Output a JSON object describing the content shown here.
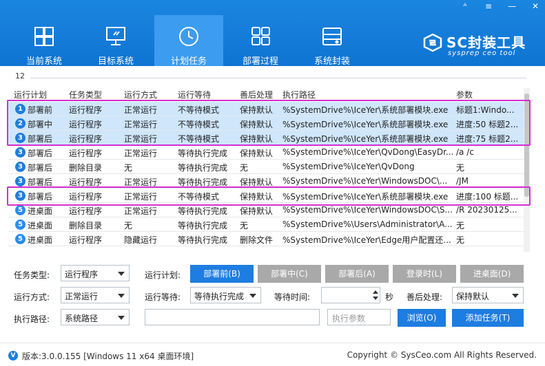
{
  "window_controls": [
    "ᴬ",
    "≡",
    "—",
    "✕"
  ],
  "nav": {
    "tabs": [
      {
        "label": "当前系统",
        "icon": "windows-icon"
      },
      {
        "label": "目标系统",
        "icon": "monitor-icon"
      },
      {
        "label": "计划任务",
        "icon": "clock-icon",
        "active": true
      },
      {
        "label": "部署过程",
        "icon": "grid-icon"
      },
      {
        "label": "系统封装",
        "icon": "drive-icon"
      }
    ]
  },
  "brand": {
    "name": "SC封装工具",
    "subtitle": "sysprep ceo tool"
  },
  "grid": {
    "count": "12",
    "columns": [
      "运行计划",
      "任务类型",
      "运行方式",
      "运行等待",
      "善后处理",
      "执行路径",
      "参数"
    ],
    "rows": [
      {
        "badge": "1",
        "plan": "部署前",
        "type": "运行程序",
        "mode": "正常运行",
        "wait": "不等待模式",
        "after": "保持默认",
        "path": "%SystemDrive%\\IceYer\\系统部署模块.exe",
        "param": "标题1:Windo..."
      },
      {
        "badge": "2",
        "plan": "部署中",
        "type": "运行程序",
        "mode": "正常运行",
        "wait": "不等待模式",
        "after": "保持默认",
        "path": "%SystemDrive%\\IceYer\\系统部署模块.exe",
        "param": "进度:50 标题2..."
      },
      {
        "badge": "3",
        "plan": "部署后",
        "type": "运行程序",
        "mode": "正常运行",
        "wait": "不等待模式",
        "after": "保持默认",
        "path": "%SystemDrive%\\IceYer\\系统部署模块.exe",
        "param": "进度:75 标题2..."
      },
      {
        "badge": "3",
        "plan": "部署后",
        "type": "运行程序",
        "mode": "正常运行",
        "wait": "等待执行完成",
        "after": "保持默认",
        "path": "%SystemDrive%\\IceYer\\QvDong\\EasyDr...",
        "param": "/a /c"
      },
      {
        "badge": "3",
        "plan": "部署后",
        "type": "删除目录",
        "mode": "无",
        "wait": "等待执行完成",
        "after": "无",
        "path": "%SystemDrive%\\IceYer\\QvDong",
        "param": "无"
      },
      {
        "badge": "3",
        "plan": "部署后",
        "type": "运行程序",
        "mode": "正常运行",
        "wait": "等待执行完成",
        "after": "保持默认",
        "path": "%SystemDrive%\\IceYer\\WindowsDOC\\...",
        "param": "/JM"
      },
      {
        "badge": "3",
        "plan": "部署后",
        "type": "运行程序",
        "mode": "正常运行",
        "wait": "不等待模式",
        "after": "保持默认",
        "path": "%SystemDrive%\\IceYer\\系统部署模块.exe",
        "param": "进度:100 标题..."
      },
      {
        "badge": "5",
        "plan": "进桌面",
        "type": "运行程序",
        "mode": "正常运行",
        "wait": "等待执行完成",
        "after": "保持默认",
        "path": "%SystemDrive%\\IceYer\\WindowsDOC\\S...",
        "param": "/R 20230125..."
      },
      {
        "badge": "5",
        "plan": "进桌面",
        "type": "删除目录",
        "mode": "无",
        "wait": "等待执行完成",
        "after": "无",
        "path": "%SystemDrive%\\Users\\Administrator\\A...",
        "param": "无"
      },
      {
        "badge": "5",
        "plan": "进桌面",
        "type": "运行程序",
        "mode": "隐藏运行",
        "wait": "等待执行完成",
        "after": "删除文件",
        "path": "%SystemDrive%\\IceYer\\Edge用户配置还...",
        "param": "无"
      }
    ]
  },
  "form": {
    "task_type_label": "任务类型:",
    "task_type_value": "运行程序",
    "run_plan_label": "运行计划:",
    "plan_buttons": [
      "部署前(B)",
      "部署中(C)",
      "部署后(A)",
      "登录时(L)",
      "进桌面(D)"
    ],
    "run_mode_label": "运行方式:",
    "run_mode_value": "正常运行",
    "run_wait_label": "运行等待:",
    "run_wait_value": "等待执行完成",
    "wait_time_label": "等待时间:",
    "wait_time_unit": "秒",
    "after_label": "善后处理:",
    "after_value": "保持默认",
    "exec_path_label": "执行路径:",
    "exec_path_value": "系统路径",
    "exec_param_placeholder": "执行参数",
    "browse_label": "浏览(O)",
    "add_task_label": "添加任务(T)"
  },
  "footer": {
    "version": "版本:3.0.0.155 [Windows 11 x64 桌面环境]",
    "copyright": "Copyright © SysCeo.com All Rights Reserved."
  },
  "colors": {
    "header": "#1a86e0",
    "active_tab": "#3c9cef",
    "accent": "#1e7de0",
    "highlight": "#d32fd3",
    "selected_row": "#cfe6fb"
  }
}
